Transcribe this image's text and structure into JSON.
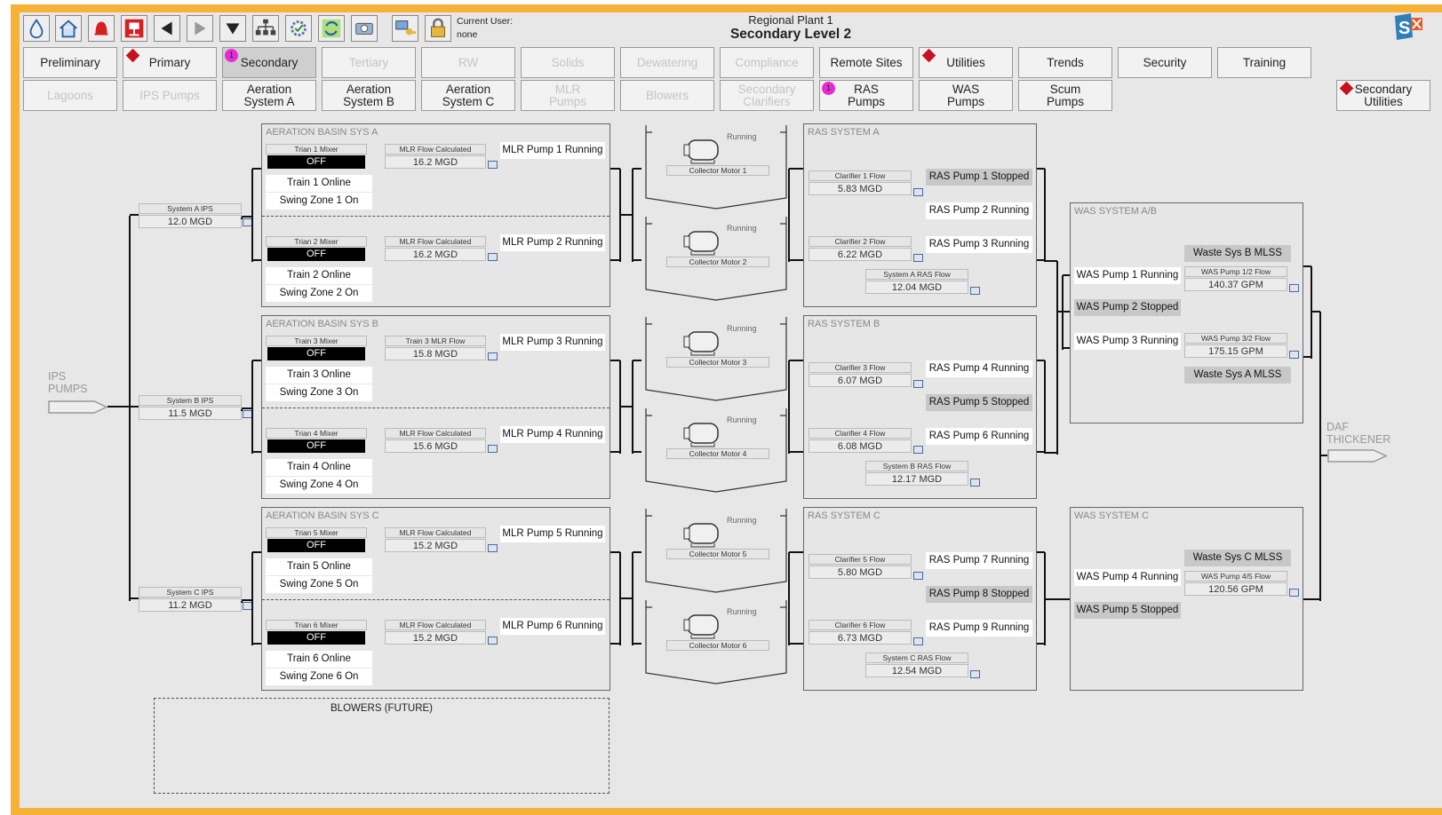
{
  "header": {
    "plant": "Regional Plant 1",
    "title": "Secondary Level 2",
    "user_label": "Current User:",
    "user": "none"
  },
  "toolbar": {
    "icons": [
      "water-drop-icon",
      "home-icon",
      "alarm-bell-icon",
      "network-alarm-icon",
      "back-arrow-icon",
      "forward-arrow-icon",
      "dropdown-arrow-icon",
      "hierarchy-icon",
      "settings-check-icon",
      "refresh-icon",
      "camera-icon",
      "login-key-icon",
      "lock-icon"
    ]
  },
  "nav_row1": [
    {
      "label": "Preliminary",
      "state": "enabled"
    },
    {
      "label": "Primary",
      "state": "enabled",
      "alarm": "diamond"
    },
    {
      "label": "Secondary",
      "state": "selected",
      "alarm_count": "1"
    },
    {
      "label": "Tertiary",
      "state": "disabled"
    },
    {
      "label": "RW",
      "state": "disabled"
    },
    {
      "label": "Solids",
      "state": "disabled"
    },
    {
      "label": "Dewatering",
      "state": "disabled"
    },
    {
      "label": "Compliance",
      "state": "disabled"
    },
    {
      "label": "Remote Sites",
      "state": "enabled"
    },
    {
      "label": "Utilities",
      "state": "enabled",
      "alarm": "diamond"
    },
    {
      "label": "Trends",
      "state": "enabled"
    },
    {
      "label": "Security",
      "state": "enabled"
    },
    {
      "label": "Training",
      "state": "enabled"
    }
  ],
  "nav_row2": [
    {
      "label": "Lagoons",
      "state": "disabled"
    },
    {
      "label": "IPS Pumps",
      "state": "disabled"
    },
    {
      "label": "Aeration\nSystem A",
      "state": "enabled"
    },
    {
      "label": "Aeration\nSystem B",
      "state": "enabled"
    },
    {
      "label": "Aeration\nSystem C",
      "state": "enabled"
    },
    {
      "label": "MLR\nPumps",
      "state": "disabled"
    },
    {
      "label": "Blowers",
      "state": "disabled"
    },
    {
      "label": "Secondary\nClarifiers",
      "state": "disabled"
    },
    {
      "label": "RAS\nPumps",
      "state": "enabled",
      "alarm_count": "1"
    },
    {
      "label": "WAS\nPumps",
      "state": "enabled"
    },
    {
      "label": "Scum\nPumps",
      "state": "enabled"
    }
  ],
  "secondary_utilities": "Secondary\nUtilities",
  "ips": {
    "label": "IPS\nPUMPS",
    "systems": [
      {
        "label": "System A IPS",
        "value": "12.0 MGD"
      },
      {
        "label": "System B IPS",
        "value": "11.5 MGD"
      },
      {
        "label": "System C IPS",
        "value": "11.2 MGD"
      }
    ]
  },
  "aeration": [
    {
      "title": "AERATION BASIN SYS A",
      "trains": [
        {
          "mixer": "Trian 1 Mixer",
          "state": "OFF",
          "flow_label": "MLR Flow Calculated",
          "flow": "16.2 MGD",
          "pump": "MLR Pump 1 Running",
          "online": "Train 1 Online",
          "swing": "Swing Zone 1 On"
        },
        {
          "mixer": "Trian 2 Mixer",
          "state": "OFF",
          "flow_label": "MLR Flow Calculated",
          "flow": "16.2 MGD",
          "pump": "MLR Pump 2 Running",
          "online": "Train 2 Online",
          "swing": "Swing Zone 2 On"
        }
      ]
    },
    {
      "title": "AERATION BASIN SYS B",
      "trains": [
        {
          "mixer": "Train 3 Mixer",
          "state": "OFF",
          "flow_label": "Train 3 MLR Flow",
          "flow": "15.8 MGD",
          "pump": "MLR Pump 3 Running",
          "online": "Train 3 Online",
          "swing": "Swing Zone 3 On"
        },
        {
          "mixer": "Trian 4 Mixer",
          "state": "OFF",
          "flow_label": "MLR Flow Calculated",
          "flow": "15.6 MGD",
          "pump": "MLR Pump 4 Running",
          "online": "Train 4 Online",
          "swing": "Swing Zone 4 On"
        }
      ]
    },
    {
      "title": "AERATION BASIN SYS C",
      "trains": [
        {
          "mixer": "Trian 5 Mixer",
          "state": "OFF",
          "flow_label": "MLR Flow Calculated",
          "flow": "15.2 MGD",
          "pump": "MLR Pump 5 Running",
          "online": "Train 5 Online",
          "swing": "Swing Zone 5 On"
        },
        {
          "mixer": "Trian 6 Mixer",
          "state": "OFF",
          "flow_label": "MLR Flow Calculated",
          "flow": "15.2 MGD",
          "pump": "MLR Pump 6 Running",
          "online": "Train 6 Online",
          "swing": "Swing Zone 6 On"
        }
      ]
    }
  ],
  "collectors": [
    {
      "label": "Collector Motor 1",
      "status": "Running"
    },
    {
      "label": "Collector Motor 2",
      "status": "Running"
    },
    {
      "label": "Collector Motor 3",
      "status": "Running"
    },
    {
      "label": "Collector Motor 4",
      "status": "Running"
    },
    {
      "label": "Collector Motor 5",
      "status": "Running"
    },
    {
      "label": "Collector Motor 6",
      "status": "Running"
    }
  ],
  "ras": [
    {
      "title": "RAS SYSTEM A",
      "c1_label": "Clarifier 1 Flow",
      "c1": "5.83 MGD",
      "c2_label": "Clarifier 2 Flow",
      "c2": "6.22 MGD",
      "sys_label": "System A RAS Flow",
      "sys": "12.04 MGD",
      "pumps": [
        {
          "text": "RAS Pump 1 Stopped",
          "stopped": true
        },
        {
          "text": "RAS Pump 2 Running",
          "stopped": false
        },
        {
          "text": "RAS Pump 3 Running",
          "stopped": false
        }
      ]
    },
    {
      "title": "RAS SYSTEM B",
      "c1_label": "Clarifier 3 Flow",
      "c1": "6.07 MGD",
      "c2_label": "Clarifier 4 Flow",
      "c2": "6.08 MGD",
      "sys_label": "System B RAS Flow",
      "sys": "12.17 MGD",
      "pumps": [
        {
          "text": "RAS Pump 4 Running",
          "stopped": false
        },
        {
          "text": "RAS Pump 5 Stopped",
          "stopped": true
        },
        {
          "text": "RAS Pump 6 Running",
          "stopped": false
        }
      ]
    },
    {
      "title": "RAS SYSTEM C",
      "c1_label": "Clarifier 5 Flow",
      "c1": "5.80 MGD",
      "c2_label": "Clarifier 6 Flow",
      "c2": "6.73 MGD",
      "sys_label": "System C RAS Flow",
      "sys": "12.54 MGD",
      "pumps": [
        {
          "text": "RAS Pump 7 Running",
          "stopped": false
        },
        {
          "text": "RAS Pump 8 Stopped",
          "stopped": true
        },
        {
          "text": "RAS Pump 9 Running",
          "stopped": false
        }
      ]
    }
  ],
  "was_ab": {
    "title": "WAS SYSTEM A/B",
    "mlss_b": "Waste Sys B MLSS",
    "mlss_a": "Waste Sys A MLSS",
    "p1": "WAS Pump 1 Running",
    "p2": "WAS Pump 2 Stopped",
    "p3": "WAS Pump 3 Running",
    "f12_label": "WAS Pump 1/2 Flow",
    "f12": "140.37 GPM",
    "f32_label": "WAS Pump 3/2 Flow",
    "f32": "175.15 GPM"
  },
  "was_c": {
    "title": "WAS SYSTEM C",
    "mlss": "Waste Sys C MLSS",
    "p4": "WAS Pump 4 Running",
    "p5": "WAS Pump 5 Stopped",
    "f45_label": "WAS Pump 4/5 Flow",
    "f45": "120.56 GPM"
  },
  "daf": "DAF\nTHICKENER",
  "blowers": "BLOWERS (FUTURE)",
  "colors": {
    "frame": "#f5b236",
    "alarm_diamond": "#c8101e",
    "alarm_circle": "#e62bd2",
    "off": "#000000"
  }
}
